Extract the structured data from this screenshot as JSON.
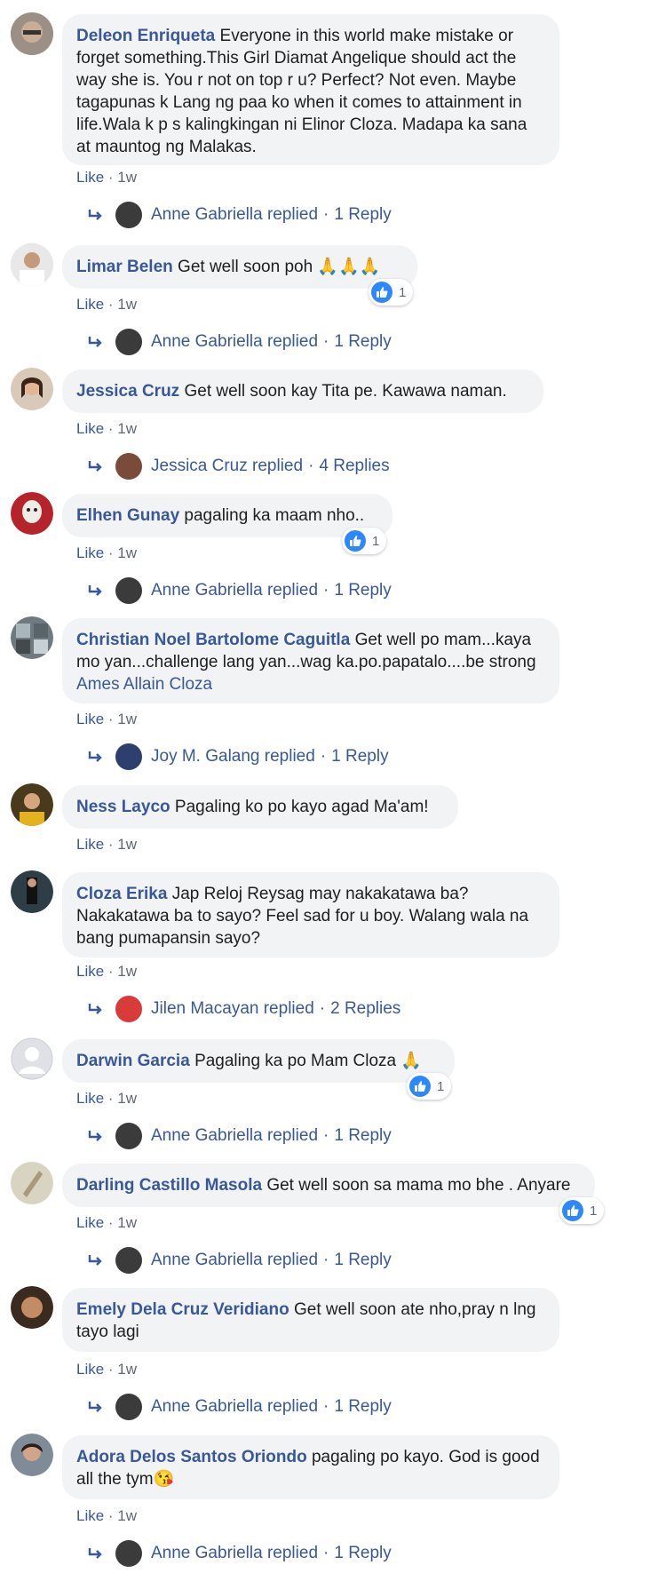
{
  "comments": [
    {
      "author": "Deleon Enriqueta",
      "text": "Everyone in this world make mistake or forget something.This Girl Diamat Angelique should act the way she is. You r not on top r u? Perfect? Not even. Maybe tagapunas k Lang ng paa ko when it comes to attainment in life.Wala k p s kalingkingan ni Elinor Cloza. Madapa ka sana at mauntog ng Malakas.",
      "like": "Like",
      "time": "1w",
      "reply_name": "Anne Gabriella replied",
      "reply_count": "1 Reply"
    },
    {
      "author": "Limar Belen",
      "text": "Get well soon poh 🙏🙏🙏",
      "like": "Like",
      "time": "1w",
      "reaction_count": "1",
      "reply_name": "Anne Gabriella replied",
      "reply_count": "1 Reply"
    },
    {
      "author": "Jessica Cruz",
      "text": "Get well soon kay Tita pe. Kawawa naman.",
      "like": "Like",
      "time": "1w",
      "reply_name": "Jessica Cruz replied",
      "reply_count": "4 Replies"
    },
    {
      "author": "Elhen Gunay",
      "text": "pagaling ka maam nho..",
      "like": "Like",
      "time": "1w",
      "reaction_count": "1",
      "reply_name": "Anne Gabriella replied",
      "reply_count": "1 Reply"
    },
    {
      "author": "Christian Noel Bartolome Caguitla",
      "text": "Get well po mam...kaya mo yan...challenge lang yan...wag ka.po.papatalo....be strong",
      "tag": "Ames Allain Cloza",
      "like": "Like",
      "time": "1w",
      "reply_name": "Joy M. Galang replied",
      "reply_count": "1 Reply"
    },
    {
      "author": "Ness Layco",
      "text": "Pagaling ko po kayo agad Ma'am!",
      "like": "Like",
      "time": "1w"
    },
    {
      "author": "Cloza Erika",
      "text": "Jap Reloj Reysag may nakakatawa ba? Nakakatawa ba to sayo? Feel sad for u boy. Walang wala na bang pumapansin sayo?",
      "like": "Like",
      "time": "1w",
      "reply_name": "Jilen Macayan replied",
      "reply_count": "2 Replies"
    },
    {
      "author": "Darwin Garcia",
      "text": "Pagaling ka po Mam Cloza 🙏",
      "like": "Like",
      "time": "1w",
      "reaction_count": "1",
      "reply_name": "Anne Gabriella replied",
      "reply_count": "1 Reply"
    },
    {
      "author": "Darling Castillo Masola",
      "text": "Get well soon sa mama mo bhe . Anyare",
      "like": "Like",
      "time": "1w",
      "reaction_count": "1",
      "reply_name": "Anne Gabriella replied",
      "reply_count": "1 Reply"
    },
    {
      "author": "Emely Dela Cruz Veridiano",
      "text": "Get well soon ate nho,pray n lng tayo lagi",
      "like": "Like",
      "time": "1w",
      "reply_name": "Anne Gabriella replied",
      "reply_count": "1 Reply"
    },
    {
      "author": "Adora Delos Santos Oriondo",
      "text": "pagaling po kayo. God is good all the tym😘",
      "like": "Like",
      "time": "1w",
      "reply_name": "Anne Gabriella replied",
      "reply_count": "1 Reply"
    }
  ],
  "icons": {
    "like": "thumbs-up-icon",
    "reply": "reply-arrow-icon"
  },
  "colors": {
    "link": "#385898",
    "bubble": "#f2f3f5",
    "like_badge": "#2d88ff",
    "meta": "#606770"
  }
}
